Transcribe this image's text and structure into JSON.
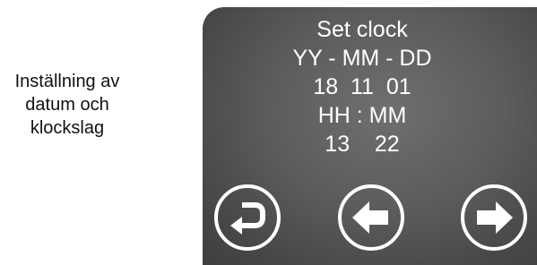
{
  "caption": {
    "lines": [
      "Inställning av",
      "datum och",
      "klockslag"
    ]
  },
  "screen": {
    "title": "Set clock",
    "date_format": "YY - MM - DD",
    "date_value": "18  11  01",
    "time_format": "HH : MM",
    "time_value": "13    22"
  },
  "buttons": {
    "back_icon": "return-icon",
    "left_icon": "arrow-left-icon",
    "right_icon": "arrow-right-icon"
  },
  "colors": {
    "screen_bg": "#5c5c5c",
    "text": "#ffffff"
  }
}
